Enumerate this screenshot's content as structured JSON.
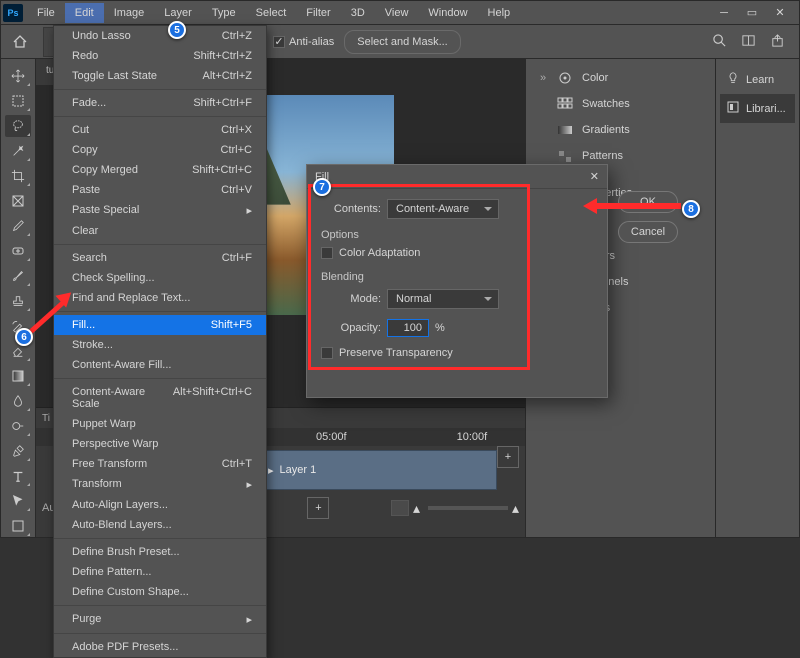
{
  "menubar": {
    "items": [
      "File",
      "Edit",
      "Image",
      "Layer",
      "Type",
      "Select",
      "Filter",
      "3D",
      "View",
      "Window",
      "Help"
    ]
  },
  "toolbar": {
    "antialias": "Anti-alias",
    "select_mask": "Select and Mask..."
  },
  "doc_tab": "tu",
  "dropdown": {
    "rows": [
      {
        "label": "Undo Lasso",
        "shortcut": "Ctrl+Z"
      },
      {
        "label": "Redo",
        "shortcut": "Shift+Ctrl+Z",
        "disabled": true
      },
      {
        "label": "Toggle Last State",
        "shortcut": "Alt+Ctrl+Z"
      },
      {
        "sep": true
      },
      {
        "label": "Fade...",
        "shortcut": "Shift+Ctrl+F",
        "disabled": true
      },
      {
        "sep": true
      },
      {
        "label": "Cut",
        "shortcut": "Ctrl+X"
      },
      {
        "label": "Copy",
        "shortcut": "Ctrl+C"
      },
      {
        "label": "Copy Merged",
        "shortcut": "Shift+Ctrl+C"
      },
      {
        "label": "Paste",
        "shortcut": "Ctrl+V"
      },
      {
        "label": "Paste Special",
        "sub": true
      },
      {
        "label": "Clear"
      },
      {
        "sep": true
      },
      {
        "label": "Search",
        "shortcut": "Ctrl+F"
      },
      {
        "label": "Check Spelling..."
      },
      {
        "label": "Find and Replace Text..."
      },
      {
        "sep": true
      },
      {
        "label": "Fill...",
        "shortcut": "Shift+F5",
        "hl": true
      },
      {
        "label": "Stroke..."
      },
      {
        "label": "Content-Aware Fill..."
      },
      {
        "sep": true
      },
      {
        "label": "Content-Aware Scale",
        "shortcut": "Alt+Shift+Ctrl+C"
      },
      {
        "label": "Puppet Warp"
      },
      {
        "label": "Perspective Warp"
      },
      {
        "label": "Free Transform",
        "shortcut": "Ctrl+T"
      },
      {
        "label": "Transform",
        "sub": true
      },
      {
        "label": "Auto-Align Layers...",
        "disabled": true
      },
      {
        "label": "Auto-Blend Layers...",
        "disabled": true
      },
      {
        "sep": true
      },
      {
        "label": "Define Brush Preset..."
      },
      {
        "label": "Define Pattern..."
      },
      {
        "label": "Define Custom Shape...",
        "disabled": true
      },
      {
        "sep": true
      },
      {
        "label": "Purge",
        "sub": true
      },
      {
        "sep": true
      },
      {
        "label": "Adobe PDF Presets..."
      }
    ]
  },
  "dialog": {
    "title": "Fill",
    "contents_lbl": "Contents:",
    "contents_val": "Content-Aware",
    "options": "Options",
    "color_adapt": "Color Adaptation",
    "blending": "Blending",
    "mode_lbl": "Mode:",
    "mode_val": "Normal",
    "opacity_lbl": "Opacity:",
    "opacity_val": "100",
    "opacity_pct": "%",
    "preserve": "Preserve Transparency",
    "ok": "OK",
    "cancel": "Cancel"
  },
  "panels": {
    "color": "Color",
    "swatches": "Swatches",
    "gradients": "Gradients",
    "patterns": "Patterns",
    "properties": "Properties",
    "adjust": "",
    "layers": "Layers",
    "channels": "Channels",
    "paths": "Paths"
  },
  "rightbar": {
    "learn": "Learn",
    "libraries": "Librari..."
  },
  "timeline": {
    "tab": "Ti",
    "ruler": [
      "05:00f",
      "10:00f"
    ],
    "layer": "Layer 1",
    "audio_tab": "Au"
  },
  "markers": {
    "m5": "5",
    "m6": "6",
    "m7": "7",
    "m8": "8"
  }
}
